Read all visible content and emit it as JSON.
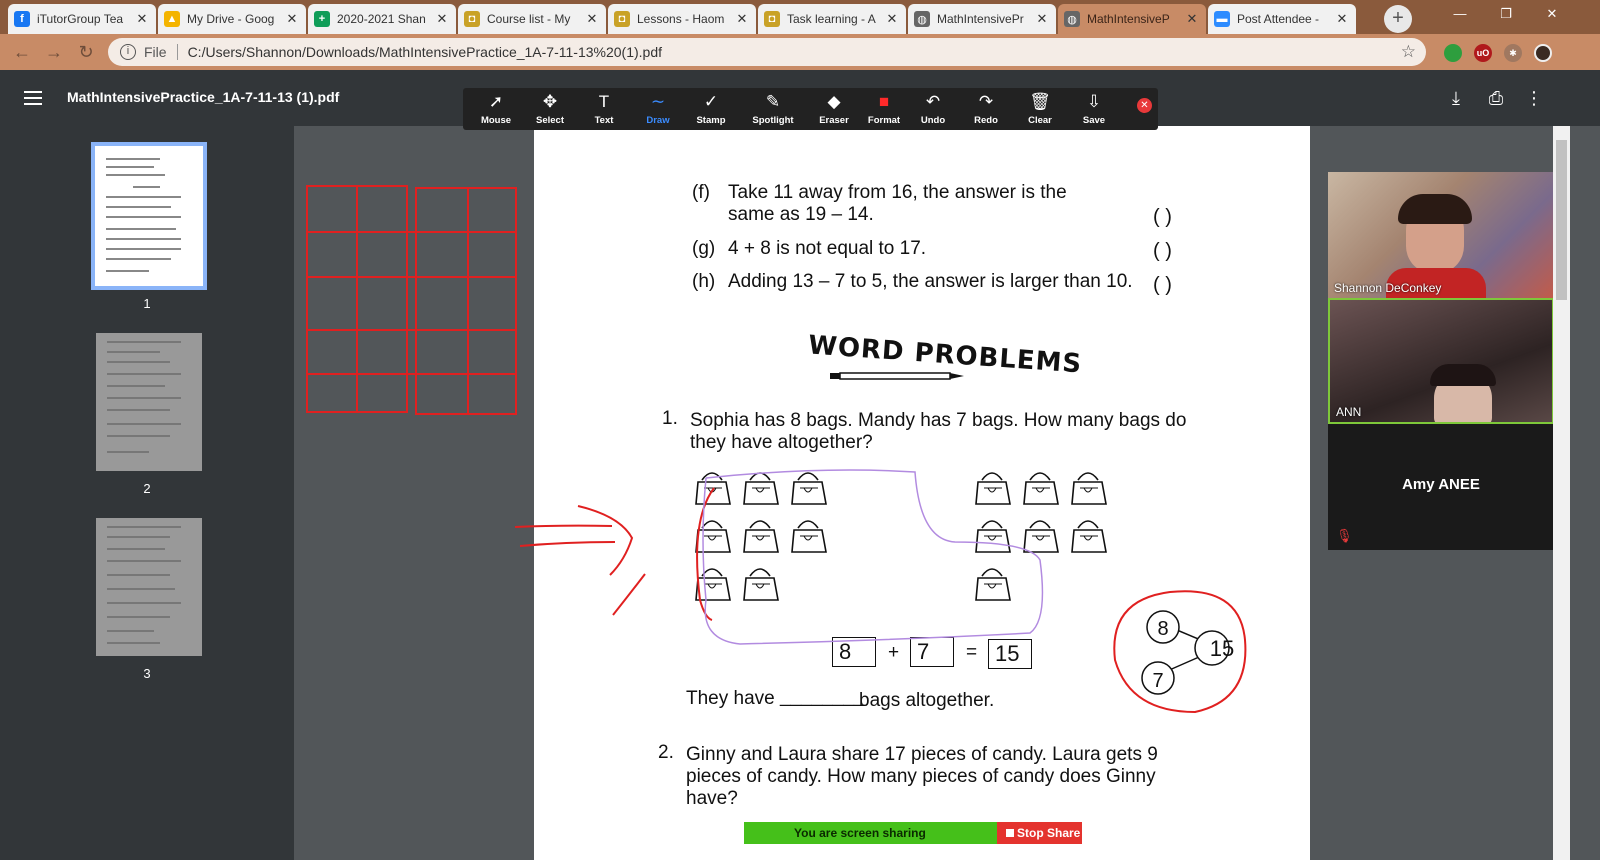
{
  "tabs": [
    {
      "label": "iTutorGroup Tea",
      "color": "#1877f2",
      "glyph": "f"
    },
    {
      "label": "My Drive - Goog",
      "color": "#f4b400",
      "glyph": "▲"
    },
    {
      "label": "2020-2021 Shan",
      "color": "#0f9d58",
      "glyph": "+"
    },
    {
      "label": "Course list - My",
      "color": "#c9a227",
      "glyph": "◘"
    },
    {
      "label": "Lessons - Haom",
      "color": "#c9a227",
      "glyph": "◘"
    },
    {
      "label": "Task learning - A",
      "color": "#c9a227",
      "glyph": "◘"
    },
    {
      "label": "MathIntensivePr",
      "color": "#666666",
      "glyph": "◍"
    },
    {
      "label": "MathIntensiveP",
      "color": "#666666",
      "glyph": "◍"
    },
    {
      "label": "Post Attendee -",
      "color": "#2d8cff",
      "glyph": "▬"
    }
  ],
  "address": {
    "scheme_label": "File",
    "url": "C:/Users/Shannon/Downloads/MathIntensivePractice_1A-7-11-13%20(1).pdf"
  },
  "viewer": {
    "title": "MathIntensivePractice_1A-7-11-13 (1).pdf",
    "pages": [
      "1",
      "2",
      "3"
    ]
  },
  "toolbar": {
    "tools": [
      {
        "label": "Mouse",
        "icon": "cursor-icon",
        "glyph": "➚"
      },
      {
        "label": "Select",
        "icon": "move-icon",
        "glyph": "✥"
      },
      {
        "label": "Text",
        "icon": "text-icon",
        "glyph": "T"
      },
      {
        "label": "Draw",
        "icon": "draw-icon",
        "glyph": "∼"
      },
      {
        "label": "Stamp",
        "icon": "check-icon",
        "glyph": "✓"
      },
      {
        "label": "Spotlight",
        "icon": "spotlight-icon",
        "glyph": "✎"
      },
      {
        "label": "Eraser",
        "icon": "eraser-icon",
        "glyph": "◆"
      },
      {
        "label": "Format",
        "icon": "format-icon",
        "glyph": "■"
      },
      {
        "label": "Undo",
        "icon": "undo-icon",
        "glyph": "↶"
      },
      {
        "label": "Redo",
        "icon": "redo-icon",
        "glyph": "↷"
      },
      {
        "label": "Clear",
        "icon": "trash-icon",
        "glyph": "🗑"
      },
      {
        "label": "Save",
        "icon": "save-icon",
        "glyph": "⇩"
      }
    ],
    "active": "Draw"
  },
  "document": {
    "items": [
      {
        "letter": "(f)",
        "line1": "Take 11 away from 16, the answer is the",
        "line2": "same as 19 – 14."
      },
      {
        "letter": "(g)",
        "line1": "4 + 8 is not equal to 17."
      },
      {
        "letter": "(h)",
        "line1": "Adding 13 – 7 to 5, the answer is larger than 10."
      }
    ],
    "paren": "(        )",
    "section_title": "WORD PROBLEMS",
    "q1_num": "1.",
    "q1_line1": "Sophia has 8 bags. Mandy has 7 bags. How many bags do",
    "q1_line2": "they have altogether?",
    "eq": {
      "a": "8",
      "plus": "+",
      "b": "7",
      "equals": "=",
      "result": "15"
    },
    "answer_prefix": "They have",
    "answer_blank": "________",
    "answer_suffix": "bags altogether.",
    "bond": {
      "top": "8",
      "bottom": "7",
      "whole": "15"
    },
    "q2_num": "2.",
    "q2_line1": "Ginny and Laura share 17 pieces of candy. Laura gets 9",
    "q2_line2": "pieces of candy. How many pieces of candy does Ginny",
    "q2_line3": "have?"
  },
  "participants": [
    {
      "name": "Shannon DeConkey"
    },
    {
      "name": "ANN"
    },
    {
      "name": "Amy ANEE"
    }
  ],
  "share": {
    "status": "You are screen sharing",
    "stop": "Stop Share"
  }
}
